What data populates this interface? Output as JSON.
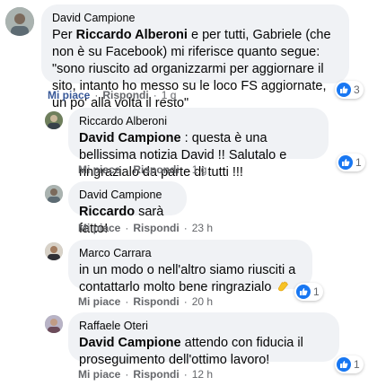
{
  "colors": {
    "bubble": "#f0f2f5",
    "like_blue": "#1877f2",
    "link_gray": "#65676b"
  },
  "comments": [
    {
      "author": "David Campione",
      "mention": "Riccardo Alberoni",
      "text_pre": "Per ",
      "text_post": " e per tutti, Gabriele (che non è su Facebook) mi riferisce quanto segue: \"sono riuscito ad organizzarmi per aggiornare il sito, intanto ho messo su le loco FS aggiornate, un po' alla volta il resto\"",
      "like_label": "Mi piace",
      "reply_label": "Rispondi",
      "time": "1 g",
      "reactions_count": "3",
      "reaction_icon": "like-icon"
    },
    {
      "author": "Riccardo Alberoni",
      "mention": "David Campione",
      "text_post": " : questa è una bellissima notizia David !! Salutalo e ringrazialo da parte di tutti !!!",
      "like_label": "Mi piace",
      "reply_label": "Rispondi",
      "time": "1 g",
      "reactions_count": "1",
      "reaction_icon": "like-icon"
    },
    {
      "author": "David Campione",
      "mention": "Riccardo",
      "text_post": " sarà fatto!",
      "like_label": "Mi piace",
      "reply_label": "Rispondi",
      "time": "23 h"
    },
    {
      "author": "Marco Carrara",
      "text": "in un modo o nell'altro siamo riusciti a contattarlo molto bene ringrazialo",
      "emoji": "clapping-hands-icon",
      "like_label": "Mi piace",
      "reply_label": "Rispondi",
      "time": "20 h",
      "reactions_count": "1",
      "reaction_icon": "like-icon"
    },
    {
      "author": "Raffaele Oteri",
      "mention": "David Campione",
      "text_post": " attendo con fiducia il proseguimento dell'ottimo lavoro!",
      "like_label": "Mi piace",
      "reply_label": "Rispondi",
      "time": "12 h",
      "reactions_count": "1",
      "reaction_icon": "like-icon"
    }
  ]
}
